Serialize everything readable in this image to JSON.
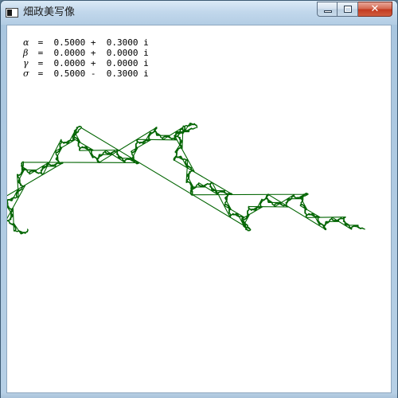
{
  "window": {
    "title": "畑政美写像",
    "controls": {
      "minimize_glyph": "",
      "maximize_glyph": "",
      "close_glyph": "✕"
    }
  },
  "readout": [
    {
      "symbol": "α",
      "text": " =  0.5000 +  0.3000 i"
    },
    {
      "symbol": "β",
      "text": " =  0.0000 +  0.0000 i"
    },
    {
      "symbol": "γ",
      "text": " =  0.0000 +  0.0000 i"
    },
    {
      "symbol": "σ",
      "text": " =  0.5000 -  0.3000 i"
    }
  ],
  "colors": {
    "curve": "#006400",
    "client_background": "#ffffff"
  }
}
